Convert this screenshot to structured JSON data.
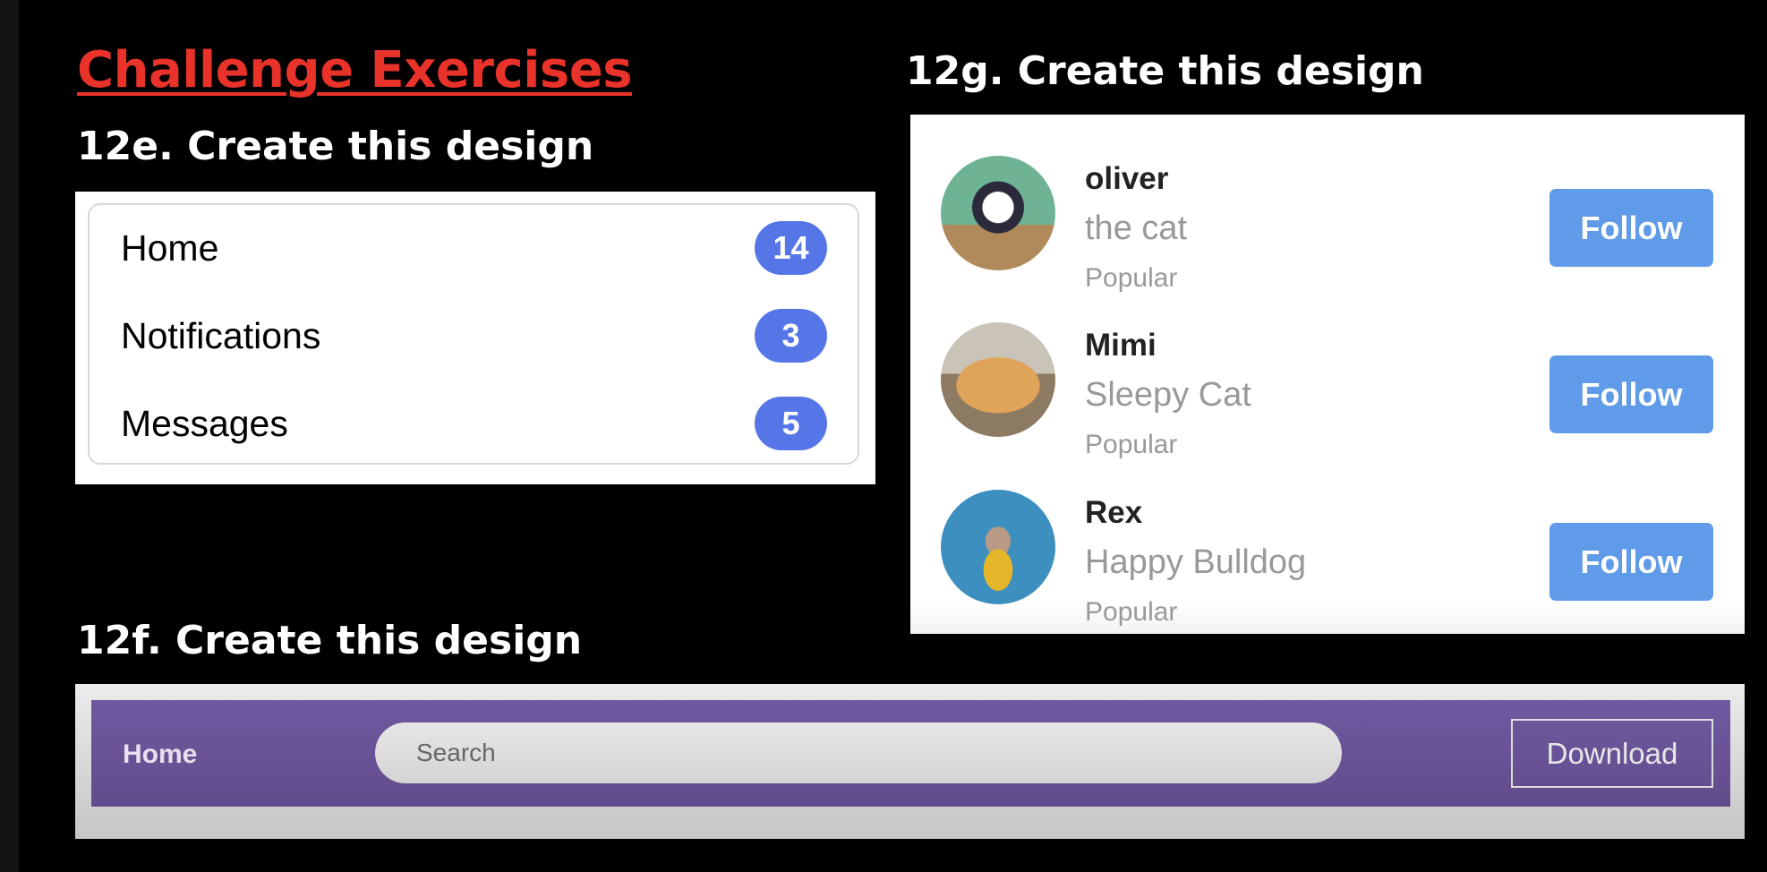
{
  "title": "Challenge Exercises",
  "exercise_e": {
    "heading": "12e. Create this design",
    "items": [
      {
        "label": "Home",
        "count": "14"
      },
      {
        "label": "Notifications",
        "count": "3"
      },
      {
        "label": "Messages",
        "count": "5"
      }
    ],
    "badge_color": "#5676e8"
  },
  "exercise_g": {
    "heading": "12g. Create this design",
    "profiles": [
      {
        "name": "oliver",
        "subtitle": "the cat",
        "tag": "Popular",
        "button": "Follow"
      },
      {
        "name": "Mimi",
        "subtitle": "Sleepy Cat",
        "tag": "Popular",
        "button": "Follow"
      },
      {
        "name": "Rex",
        "subtitle": "Happy Bulldog",
        "tag": "Popular",
        "button": "Follow"
      }
    ],
    "button_color": "#5f9be8"
  },
  "exercise_f": {
    "heading": "12f. Create this design",
    "nav_home": "Home",
    "search_placeholder": "Search",
    "download_label": "Download",
    "bar_color": "#6a54983"
  }
}
